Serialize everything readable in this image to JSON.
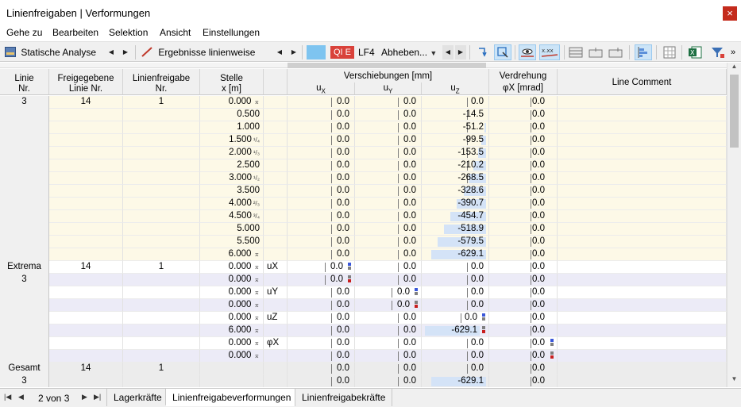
{
  "window": {
    "title": "Linienfreigaben | Verformungen",
    "close_glyph": "×"
  },
  "menu": [
    "Gehe zu",
    "Bearbeiten",
    "Selektion",
    "Ansicht",
    "Einstellungen"
  ],
  "toolbar": {
    "analysis": "Statische Analyse",
    "results": "Ergebnisse linienweise",
    "badge": "QI E",
    "loadcase": "LF4",
    "loadcase_name": "Abheben..."
  },
  "headers": {
    "linie": [
      "Linie",
      "Nr."
    ],
    "freigegebene": [
      "Freigegebene",
      "Linie Nr."
    ],
    "linienfreigabe": [
      "Linienfreigabe",
      "Nr."
    ],
    "stelle": [
      "Stelle",
      "x [m]"
    ],
    "verschiebungen": "Verschiebungen [mm]",
    "ux": "uX",
    "uy": "uY",
    "uz": "uZ",
    "verdrehung": "Verdrehung",
    "phi": "φX [mrad]",
    "comment": "Line Comment"
  },
  "rows": [
    {
      "linie": "3",
      "freig": "14",
      "lfnr": "1",
      "stelle": "0.000",
      "mark": "⌅",
      "frac": "",
      "comp": "",
      "ux": "0.0",
      "uy": "0.0",
      "uz": "0.0",
      "phi": "0.0",
      "bar": 0,
      "sq": "",
      "group": "y"
    },
    {
      "linie": "",
      "freig": "",
      "lfnr": "",
      "stelle": "0.500",
      "mark": "",
      "frac": "",
      "comp": "",
      "ux": "0.0",
      "uy": "0.0",
      "uz": "-14.5",
      "phi": "0.0",
      "bar": 0,
      "sq": "",
      "group": "y"
    },
    {
      "linie": "",
      "freig": "",
      "lfnr": "",
      "stelle": "1.000",
      "mark": "",
      "frac": "",
      "comp": "",
      "ux": "0.0",
      "uy": "0.0",
      "uz": "-51.2",
      "phi": "0.0",
      "bar": 0.03,
      "sq": "",
      "group": "y"
    },
    {
      "linie": "",
      "freig": "",
      "lfnr": "",
      "stelle": "1.500",
      "mark": "",
      "frac": "¹/₄",
      "comp": "",
      "ux": "0.0",
      "uy": "0.0",
      "uz": "-99.5",
      "phi": "0.0",
      "bar": 0.08,
      "sq": "",
      "group": "y"
    },
    {
      "linie": "",
      "freig": "",
      "lfnr": "",
      "stelle": "2.000",
      "mark": "",
      "frac": "¹/₃",
      "comp": "",
      "ux": "0.0",
      "uy": "0.0",
      "uz": "-153.5",
      "phi": "0.0",
      "bar": 0.13,
      "sq": "",
      "group": "y"
    },
    {
      "linie": "",
      "freig": "",
      "lfnr": "",
      "stelle": "2.500",
      "mark": "",
      "frac": "",
      "comp": "",
      "ux": "0.0",
      "uy": "0.0",
      "uz": "-210.2",
      "phi": "0.0",
      "bar": 0.2,
      "sq": "",
      "group": "y"
    },
    {
      "linie": "",
      "freig": "",
      "lfnr": "",
      "stelle": "3.000",
      "mark": "",
      "frac": "¹/₂",
      "comp": "",
      "ux": "0.0",
      "uy": "0.0",
      "uz": "-268.5",
      "phi": "0.0",
      "bar": 0.27,
      "sq": "",
      "group": "y"
    },
    {
      "linie": "",
      "freig": "",
      "lfnr": "",
      "stelle": "3.500",
      "mark": "",
      "frac": "",
      "comp": "",
      "ux": "0.0",
      "uy": "0.0",
      "uz": "-328.6",
      "phi": "0.0",
      "bar": 0.35,
      "sq": "",
      "group": "y"
    },
    {
      "linie": "",
      "freig": "",
      "lfnr": "",
      "stelle": "4.000",
      "mark": "",
      "frac": "²/₃",
      "comp": "",
      "ux": "0.0",
      "uy": "0.0",
      "uz": "-390.7",
      "phi": "0.0",
      "bar": 0.46,
      "sq": "",
      "group": "y"
    },
    {
      "linie": "",
      "freig": "",
      "lfnr": "",
      "stelle": "4.500",
      "mark": "",
      "frac": "³/₄",
      "comp": "",
      "ux": "0.0",
      "uy": "0.0",
      "uz": "-454.7",
      "phi": "0.0",
      "bar": 0.56,
      "sq": "",
      "group": "y"
    },
    {
      "linie": "",
      "freig": "",
      "lfnr": "",
      "stelle": "5.000",
      "mark": "",
      "frac": "",
      "comp": "",
      "ux": "0.0",
      "uy": "0.0",
      "uz": "-518.9",
      "phi": "0.0",
      "bar": 0.66,
      "sq": "",
      "group": "y"
    },
    {
      "linie": "",
      "freig": "",
      "lfnr": "",
      "stelle": "5.500",
      "mark": "",
      "frac": "",
      "comp": "",
      "ux": "0.0",
      "uy": "0.0",
      "uz": "-579.5",
      "phi": "0.0",
      "bar": 0.76,
      "sq": "",
      "group": "y"
    },
    {
      "linie": "",
      "freig": "",
      "lfnr": "",
      "stelle": "6.000",
      "mark": "⌅",
      "frac": "",
      "comp": "",
      "ux": "0.0",
      "uy": "0.0",
      "uz": "-629.1",
      "phi": "0.0",
      "bar": 0.86,
      "sq": "",
      "group": "y"
    },
    {
      "linie": "Extrema",
      "freig": "14",
      "lfnr": "1",
      "stelle": "0.000",
      "mark": "⌅",
      "frac": "",
      "comp": "uX",
      "ux": "0.0",
      "uy": "0.0",
      "uz": "0.0",
      "phi": "0.0",
      "bar": 0,
      "sq": "ux-blue",
      "group": "w"
    },
    {
      "linie": "3",
      "freig": "",
      "lfnr": "",
      "stelle": "0.000",
      "mark": "⌅",
      "frac": "",
      "comp": "",
      "ux": "0.0",
      "uy": "0.0",
      "uz": "0.0",
      "phi": "0.0",
      "bar": 0,
      "sq": "ux-red",
      "group": "p"
    },
    {
      "linie": "",
      "freig": "",
      "lfnr": "",
      "stelle": "0.000",
      "mark": "⌅",
      "frac": "",
      "comp": "uY",
      "ux": "0.0",
      "uy": "0.0",
      "uz": "0.0",
      "phi": "0.0",
      "bar": 0,
      "sq": "uy-blue",
      "group": "w"
    },
    {
      "linie": "",
      "freig": "",
      "lfnr": "",
      "stelle": "0.000",
      "mark": "⌅",
      "frac": "",
      "comp": "",
      "ux": "0.0",
      "uy": "0.0",
      "uz": "0.0",
      "phi": "0.0",
      "bar": 0,
      "sq": "uy-red",
      "group": "p"
    },
    {
      "linie": "",
      "freig": "",
      "lfnr": "",
      "stelle": "0.000",
      "mark": "⌅",
      "frac": "",
      "comp": "uZ",
      "ux": "0.0",
      "uy": "0.0",
      "uz": "0.0",
      "phi": "0.0",
      "bar": 0,
      "sq": "uz-blue",
      "group": "w"
    },
    {
      "linie": "",
      "freig": "",
      "lfnr": "",
      "stelle": "6.000",
      "mark": "⌅",
      "frac": "",
      "comp": "",
      "ux": "0.0",
      "uy": "0.0",
      "uz": "-629.1",
      "phi": "0.0",
      "bar": 0.86,
      "sq": "uz-red",
      "group": "p"
    },
    {
      "linie": "",
      "freig": "",
      "lfnr": "",
      "stelle": "0.000",
      "mark": "⌅",
      "frac": "",
      "comp": "φX",
      "ux": "0.0",
      "uy": "0.0",
      "uz": "0.0",
      "phi": "0.0",
      "bar": 0,
      "sq": "phi-blue",
      "group": "w"
    },
    {
      "linie": "",
      "freig": "",
      "lfnr": "",
      "stelle": "0.000",
      "mark": "⌅",
      "frac": "",
      "comp": "",
      "ux": "0.0",
      "uy": "0.0",
      "uz": "0.0",
      "phi": "0.0",
      "bar": 0,
      "sq": "phi-red",
      "group": "p"
    },
    {
      "linie": "Gesamt",
      "freig": "14",
      "lfnr": "1",
      "stelle": "",
      "mark": "",
      "frac": "",
      "comp": "",
      "ux": "0.0",
      "uy": "0.0",
      "uz": "0.0",
      "phi": "0.0",
      "bar": 0,
      "sq": "",
      "group": "g"
    },
    {
      "linie": "3",
      "freig": "",
      "lfnr": "",
      "stelle": "",
      "mark": "",
      "frac": "",
      "comp": "",
      "ux": "0.0",
      "uy": "0.0",
      "uz": "-629.1",
      "phi": "0.0",
      "bar": 0.86,
      "sq": "",
      "group": "g"
    }
  ],
  "colors": {
    "row_yellow": "#fdf9e7",
    "row_white": "#ffffff",
    "row_purple": "#ecebf7",
    "row_gray": "#ececec",
    "bar": "#d4e3f7",
    "marker_blue": "#3a57d9",
    "marker_red": "#c81e1e",
    "marker_gray": "#808080",
    "badge_red": "#d9413a",
    "badge_blue": "#7ec4f0"
  },
  "pager": {
    "text": "2 von 3"
  },
  "tabs": [
    {
      "label": "Lagerkräfte",
      "active": false
    },
    {
      "label": "Linienfreigabeverformungen",
      "active": true
    },
    {
      "label": "Linienfreigabekräfte",
      "active": false
    }
  ]
}
